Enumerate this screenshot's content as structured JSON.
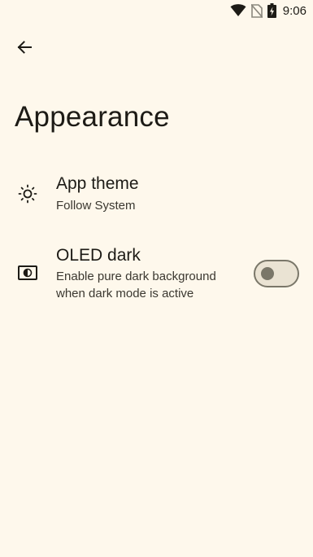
{
  "status_bar": {
    "time": "9:06",
    "icons": [
      "wifi-icon",
      "no-sim-icon",
      "battery-charging-icon"
    ]
  },
  "header": {
    "back_icon": "arrow-back-icon",
    "title": "Appearance"
  },
  "settings": [
    {
      "icon": "brightness-icon",
      "title": "App theme",
      "subtitle": "Follow System"
    },
    {
      "icon": "oled-contrast-icon",
      "title": "OLED dark",
      "subtitle": "Enable pure dark background when dark mode is active",
      "switch_on": false
    }
  ],
  "colors": {
    "background": "#fef8ec",
    "text": "#1d1b16",
    "switch_outline": "#7a7769",
    "switch_track": "#eae3d3"
  }
}
